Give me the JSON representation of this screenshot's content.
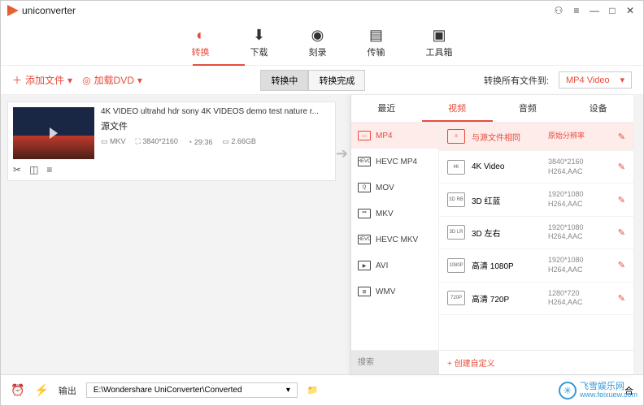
{
  "app": {
    "name": "uniconverter"
  },
  "window_buttons": {
    "user": "⚇",
    "menu": "≡",
    "min": "—",
    "max": "□",
    "close": "✕"
  },
  "main_tabs": [
    {
      "label": "转换",
      "icon": "▶"
    },
    {
      "label": "下载",
      "icon": "⬇"
    },
    {
      "label": "刻录",
      "icon": "◉"
    },
    {
      "label": "传输",
      "icon": "📁"
    },
    {
      "label": "工具箱",
      "icon": "🧰"
    }
  ],
  "toolbar": {
    "add_file": "添加文件",
    "load_dvd": "加载DVD",
    "seg_converting": "转换中",
    "seg_done": "转换完成",
    "convert_all_label": "转换所有文件到:",
    "format_selected": "MP4 Video"
  },
  "file": {
    "title": "4K VIDEO ultrahd hdr sony 4K VIDEOS demo test nature r...",
    "source_label": "源文件",
    "container": "MKV",
    "resolution": "3840*2160",
    "duration": "29:36",
    "size": "2.66GB"
  },
  "panel_tabs": {
    "recent": "最近",
    "video": "视频",
    "audio": "音频",
    "device": "设备"
  },
  "formats": [
    "MP4",
    "HEVC MP4",
    "MOV",
    "MKV",
    "HEVC MKV",
    "AVI",
    "WMV"
  ],
  "presets": [
    {
      "name": "与源文件相同",
      "spec": "原始分辨率",
      "hl": true,
      "ic": ""
    },
    {
      "name": "4K Video",
      "spec1": "3840*2160",
      "spec2": "H264,AAC",
      "ic": "4K"
    },
    {
      "name": "3D 红蓝",
      "spec1": "1920*1080",
      "spec2": "H264,AAC",
      "ic": "3D RB"
    },
    {
      "name": "3D 左右",
      "spec1": "1920*1080",
      "spec2": "H264,AAC",
      "ic": "3D LR"
    },
    {
      "name": "高清 1080P",
      "spec1": "1920*1080",
      "spec2": "H264,AAC",
      "ic": "1080P"
    },
    {
      "name": "高清 720P",
      "spec1": "1280*720",
      "spec2": "H264,AAC",
      "ic": "720P"
    }
  ],
  "panel_footer": {
    "search": "搜索",
    "custom": "+  创建自定义"
  },
  "bottom": {
    "output_label": "输出",
    "output_path": "E:\\Wondershare UniConverter\\Converted",
    "merge": "合"
  },
  "watermark": {
    "name": "飞雪娱乐网",
    "url": "www.feixuew.com"
  }
}
